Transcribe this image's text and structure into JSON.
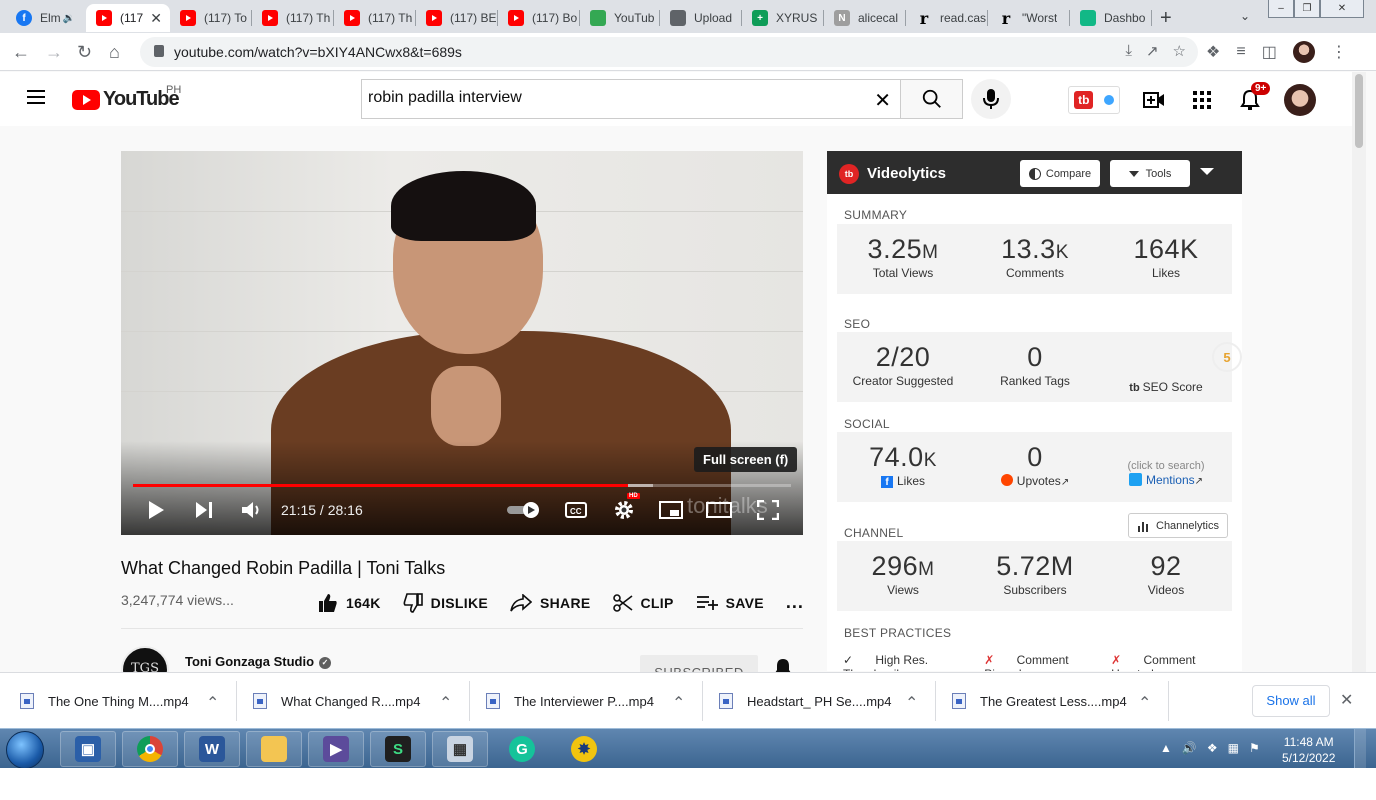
{
  "browser": {
    "tabs": [
      {
        "title": "Elm",
        "fav": "f",
        "kind": "facebook",
        "audio": true
      },
      {
        "title": "(117",
        "fav": "",
        "kind": "youtube",
        "active": true
      },
      {
        "title": "(117) To",
        "fav": "",
        "kind": "youtube"
      },
      {
        "title": "(117) Th",
        "fav": "",
        "kind": "youtube"
      },
      {
        "title": "(117) Th",
        "fav": "",
        "kind": "youtube"
      },
      {
        "title": "(117) BE",
        "fav": "",
        "kind": "youtube"
      },
      {
        "title": "(117) Bo",
        "fav": "",
        "kind": "youtube"
      },
      {
        "title": "YouTub",
        "fav": "",
        "kind": "download"
      },
      {
        "title": "Upload",
        "fav": "",
        "kind": "upload"
      },
      {
        "title": "XYRUS",
        "fav": "+",
        "kind": "sheets"
      },
      {
        "title": "alicecal",
        "fav": "N",
        "kind": "other"
      },
      {
        "title": "read.cas",
        "fav": "r",
        "kind": "read"
      },
      {
        "title": "\"Worst",
        "fav": "r",
        "kind": "read"
      },
      {
        "title": "Dashbo",
        "fav": "",
        "kind": "dashboard"
      }
    ],
    "url": "youtube.com/watch?v=bXIY4ANCwx8&t=689s"
  },
  "youtube": {
    "logo_text": "YouTube",
    "country_code": "PH",
    "search_value": "robin padilla interview",
    "notification_count": "9+",
    "ext_label": "tb"
  },
  "player": {
    "current_time": "21:15",
    "duration": "28:16",
    "time_display": "21:15 / 28:16",
    "progress_fraction": 0.752,
    "buffered_fraction": 0.79,
    "tooltip": "Full screen (f)",
    "hd_badge": "HD",
    "watermark": "tonitalks"
  },
  "video": {
    "title": "What Changed Robin Padilla | Toni Talks",
    "views": "3,247,774 views...",
    "likes": "164K",
    "dislike": "DISLIKE",
    "share": "SHARE",
    "clip": "CLIP",
    "save": "SAVE",
    "more": "..."
  },
  "channel": {
    "name": "Toni Gonzaga Studio",
    "subscribed": "SUBSCRIBED",
    "avatar_text": "TGS"
  },
  "videolytics": {
    "logo": "tb",
    "name": "Videolytics",
    "compare": "Compare",
    "tools": "Tools",
    "summary": {
      "label": "SUMMARY",
      "views_num": "3.25",
      "views_unit": "M",
      "views_label": "Total Views",
      "comments_num": "13.3",
      "comments_unit": "K",
      "comments_label": "Comments",
      "likes_num": "164K",
      "likes_label": "Likes"
    },
    "seo": {
      "label": "SEO",
      "suggested": "2/20",
      "suggested_label": "Creator Suggested",
      "ranked": "0",
      "ranked_label": "Ranked Tags",
      "score": "5",
      "score_label": "SEO Score"
    },
    "social": {
      "label": "SOCIAL",
      "likes_num": "74.0",
      "likes_unit": "K",
      "likes_label": "Likes",
      "upvotes": "0",
      "upvotes_label": "Upvotes",
      "click_to_search": "(click to search)",
      "mentions_label": "Mentions"
    },
    "channel": {
      "label": "CHANNEL",
      "channelytics": "Channelytics",
      "views_num": "296",
      "views_unit": "M",
      "views_label": "Views",
      "subs_num": "5.72M",
      "subs_label": "Subscribers",
      "videos_num": "92",
      "videos_label": "Videos"
    },
    "best_practices": {
      "label": "BEST PRACTICES",
      "items": [
        "High Res. Thumbnail",
        "Comment Pinned",
        "Comment Hearted"
      ],
      "status": [
        "pass",
        "fail",
        "fail"
      ]
    }
  },
  "downloads": {
    "items": [
      "The One Thing M....mp4",
      "What Changed R....mp4",
      "The Interviewer P....mp4",
      "Headstart_ PH Se....mp4",
      "The Greatest Less....mp4"
    ],
    "show_all": "Show all"
  },
  "taskbar": {
    "time": "11:48 AM",
    "date": "5/12/2022"
  },
  "colors": {
    "yt_red": "#ff0000",
    "tb_red": "#e02424",
    "link_blue": "#1a5fb4",
    "fail_red": "#dd3333",
    "taskbar": "#3c6590"
  }
}
